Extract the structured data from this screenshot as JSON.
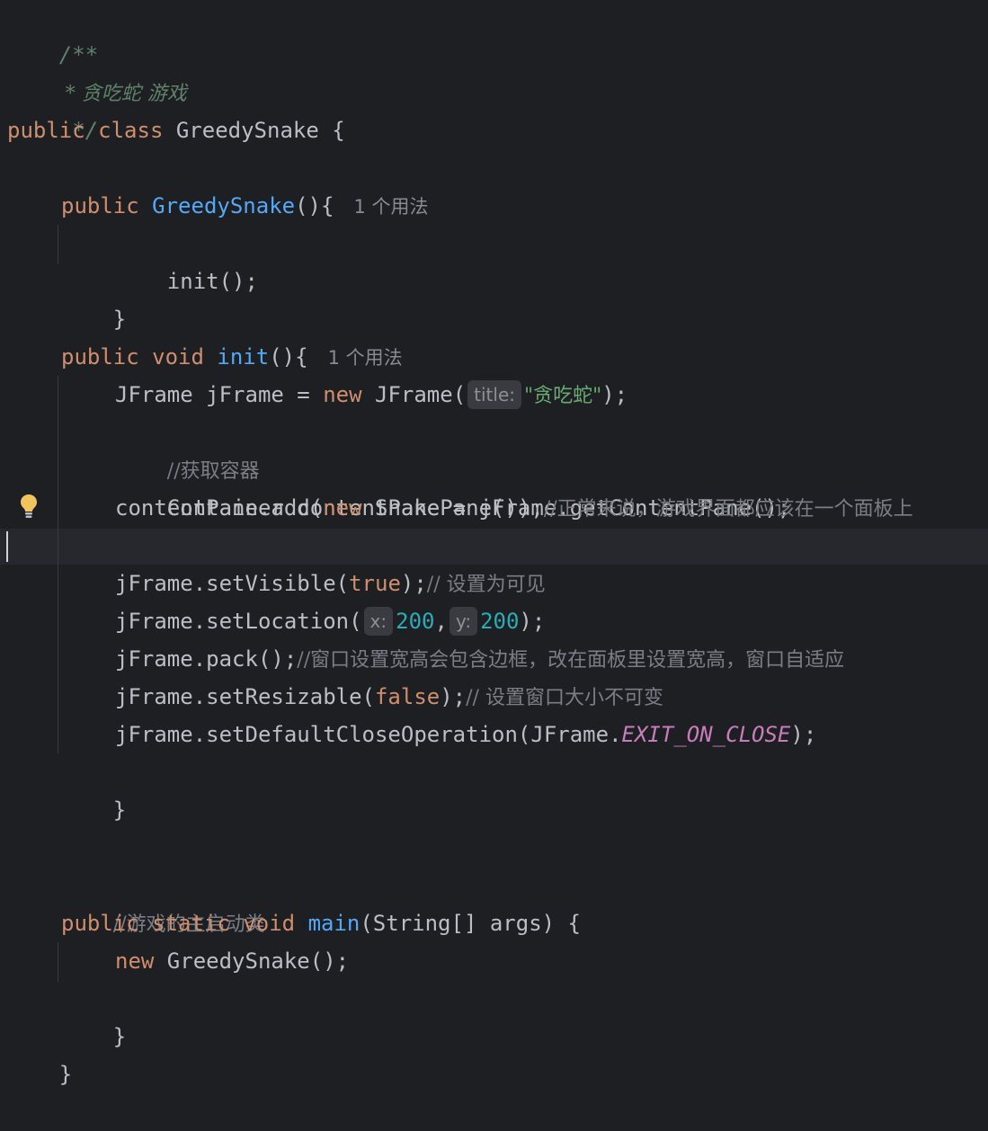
{
  "editor": {
    "language": "Java",
    "theme_colors": {
      "background": "#1e1f22",
      "keyword": "#cf8e6d",
      "function": "#56a8f5",
      "string": "#6aab73",
      "number": "#2aacb8",
      "constant": "#c77dbb",
      "doc_comment": "#5f826b",
      "comment": "#7a7e85",
      "default_text": "#bcbec4"
    },
    "code": {
      "doc_open": "/**",
      "doc_body": " * 贪吃蛇 游戏",
      "doc_close": " */",
      "class_kw_public": "public",
      "class_kw_class": "class",
      "class_name_rest": " GreedySnake {",
      "ctor_kw_public": "public",
      "ctor_name": "GreedySnake",
      "ctor_rest": "(){",
      "ctor_usage_hint": "1 个用法",
      "ctor_body": "init();",
      "ctor_close": "}",
      "init_kw_public": "public",
      "init_kw_void": "void",
      "init_name": "init",
      "init_rest": "(){",
      "init_usage_hint": "1 个用法",
      "jframe_decl": "JFrame jFrame = ",
      "jframe_new": "new",
      "jframe_ctor": " JFrame(",
      "title_hint": "title:",
      "title_string": "\"贪吃蛇\"",
      "jframe_end": ");",
      "comment_get_container": "//获取容器",
      "container_line": "Container contentPane = jFrame.getContentPane();",
      "add_start": "contentPane.add(",
      "add_new": "new",
      "add_rest": " SnakePane());",
      "add_comment": "//正常来说，游戏界面都应该在一个面板上",
      "visible_start": "jFrame.setVisible(",
      "visible_true": "true",
      "visible_end": ");",
      "visible_comment": "// 设置为可见",
      "location_start": "jFrame.setLocation(",
      "x_hint": "x:",
      "x_value": "200",
      "comma": ",",
      "y_hint": "y:",
      "y_value": "200",
      "location_end": ");",
      "pack_code": "jFrame.pack();",
      "pack_comment": "//窗口设置宽高会包含边框，改在面板里设置宽高，窗口自适应",
      "resizable_start": "jFrame.setResizable(",
      "resizable_false": "false",
      "resizable_end": ");",
      "resizable_comment": "// 设置窗口大小不可变",
      "close_start": "jFrame.setDefaultCloseOperation(JFrame.",
      "close_const": "EXIT_ON_CLOSE",
      "close_end": ");",
      "init_close": "}",
      "main_comment": "//游戏的主启动类",
      "main_kw_public": "public",
      "main_kw_static": "static",
      "main_kw_void": "void",
      "main_name": "main",
      "main_rest": "(String[] args) {",
      "main_new": "new",
      "main_body_rest": " GreedySnake();",
      "main_close": "}",
      "class_close": "}"
    },
    "gutter": {
      "intention_icon": "lightbulb-icon"
    }
  }
}
